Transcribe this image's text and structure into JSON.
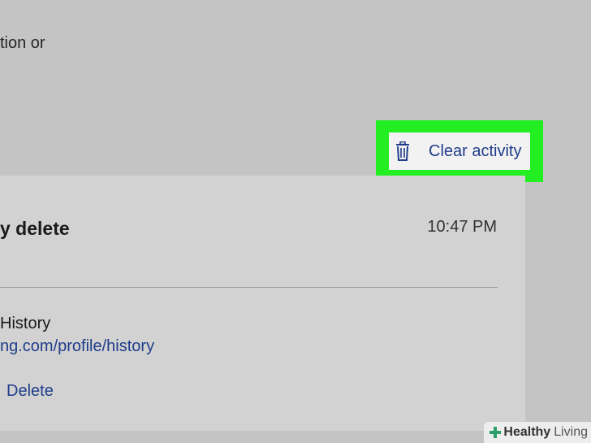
{
  "header": {
    "intro_text": "tion or"
  },
  "toolbar": {
    "clear_activity_label": "Clear activity",
    "clear_icon": "trash-icon",
    "highlight_color": "#22ee22"
  },
  "activity_card": {
    "title": "y delete",
    "time": "10:47 PM",
    "entry": {
      "title": "History",
      "url": "ng.com/profile/history",
      "delete_label": "Delete"
    }
  },
  "watermark": {
    "part1": "Healthy",
    "part2": "Living"
  },
  "colors": {
    "page_background": "#c4c4c4",
    "card_background": "#d2d2d2",
    "link": "#1f3d8a"
  }
}
